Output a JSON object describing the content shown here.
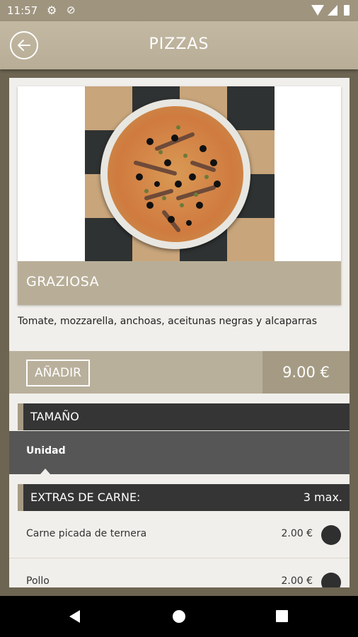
{
  "status_bar": {
    "time": "11:57",
    "icons": [
      "settings-icon",
      "no-disturb-icon",
      "wifi-icon",
      "cell-signal-icon",
      "battery-icon"
    ]
  },
  "app_bar": {
    "title": "PIZZAS",
    "back_icon": "arrow-left-icon"
  },
  "product": {
    "name": "GRAZIOSA",
    "description": "Tomate, mozzarella, anchoas, aceitunas negras y alcaparras",
    "add_label": "AÑADIR",
    "price": "9.00 €"
  },
  "size_section": {
    "title": "TAMAÑO",
    "options": [
      "Unidad"
    ]
  },
  "extras_section": {
    "title": "EXTRAS DE CARNE:",
    "max_label": "3 max.",
    "items": [
      {
        "name": "Carne picada de ternera",
        "price": "2.00 €"
      },
      {
        "name": "Pollo",
        "price": "2.00 €"
      }
    ]
  },
  "colors": {
    "accent": "#b8ae98",
    "dark_header": "#353535",
    "background": "#f1efeb"
  }
}
